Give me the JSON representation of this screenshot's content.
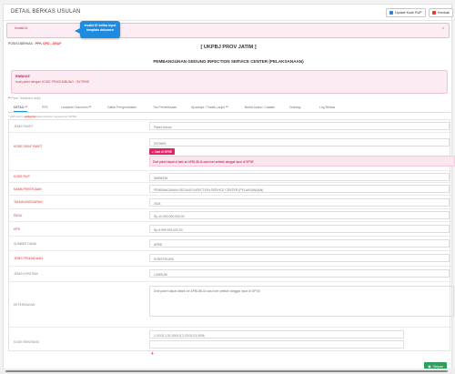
{
  "header": {
    "title": "DETAIL BERKAS USULAN",
    "update_btn": "Update Kode RUP",
    "back_btn": "Kembali"
  },
  "alert": {
    "text": "Invalid id",
    "close": "×"
  },
  "tooltip": {
    "line1": "Invalid ID ketika input",
    "line2": "template dokumen"
  },
  "posisi": {
    "label": "POSISI BERKAS : ",
    "value": "PPK OPD - DRAF"
  },
  "heading": "[ UKPBJ PROV JATIM ]",
  "subheading": "PEMBANGUNAN GEDUNG INFECTION SERVICE CENTER (PELAKSANAAN)",
  "riwayat": {
    "title": "RIWAYAT:",
    "text": "buat paket dengan KODE PENGHUBUNG : '5479905'"
  },
  "required_note": {
    "mark": "**",
    "text": "Perlu Tindakan Lanjut"
  },
  "tabs": [
    {
      "label": "DETAIL",
      "mark": "**"
    },
    {
      "label": "PPK",
      "mark": ""
    },
    {
      "label": "Lampiran Dokumen",
      "mark": "**"
    },
    {
      "label": "Daftar Pengembalian",
      "mark": ""
    },
    {
      "label": "Tim Pemeriksaan",
      "mark": ""
    },
    {
      "label": "Ajuannya / Tindak Lanjut",
      "mark": "**"
    },
    {
      "label": "Berita Acara / Catatan",
      "mark": ""
    },
    {
      "label": "Drawing",
      "mark": ""
    },
    {
      "label": "Log Berkas",
      "mark": ""
    }
  ],
  "field_note": {
    "pre": "* pilih warna ",
    "mid": "pinkpink",
    "post": " data sebelum sesuai dari SPSE"
  },
  "fields": {
    "jenis_paket": {
      "label": "JENIS PAKET",
      "value": "Paket Umum"
    },
    "kode_draf": {
      "label": "KODE DRAF PAKET",
      "value": "5479905",
      "sipd_btn": "Cari di SPSE",
      "info": "Draf paket dapat di tarik ke APBLIBLIA satu hari setelah tanggal input di SPSE"
    },
    "kode_rup": {
      "label": "KODE RUP",
      "value": "55535296"
    },
    "nama_pekerjaan": {
      "label": "NAMA PEKERJAAN",
      "value": "PEMBANGUNAN GEDUNG INFECTION SERVICE CENTER (PELAKSANAAN)"
    },
    "tahun_anggaran": {
      "label": "TAHUN ANGGARAN",
      "value": "2024"
    },
    "pagu": {
      "label": "PAGU",
      "value": "Rp.10,000,000,000.00"
    },
    "hps": {
      "label": "HPS",
      "value": "Rp.9,999,924,000.00"
    },
    "sumber_dana": {
      "label": "SUMBER DANA",
      "value": "APBD"
    },
    "jenis_pengadaan": {
      "label": "JENIS PENGADAAN",
      "value": "KONSTRUKSI"
    },
    "jenis_kontrak": {
      "label": "JENIS KONTRAK",
      "value": "LUMSUM"
    },
    "keterangan": {
      "label": "KETERANGAN",
      "value": "Draf paket dapat ditarik ke APBLIBLIA satu hari setelah tanggal input di SPSE"
    },
    "kode_rekening": {
      "label": "KODE REKENING",
      "value": "1.02.02.1.01.0001.5.2.03.01.01.0006",
      "plus": "+"
    }
  },
  "save_btn": "Simpan"
}
